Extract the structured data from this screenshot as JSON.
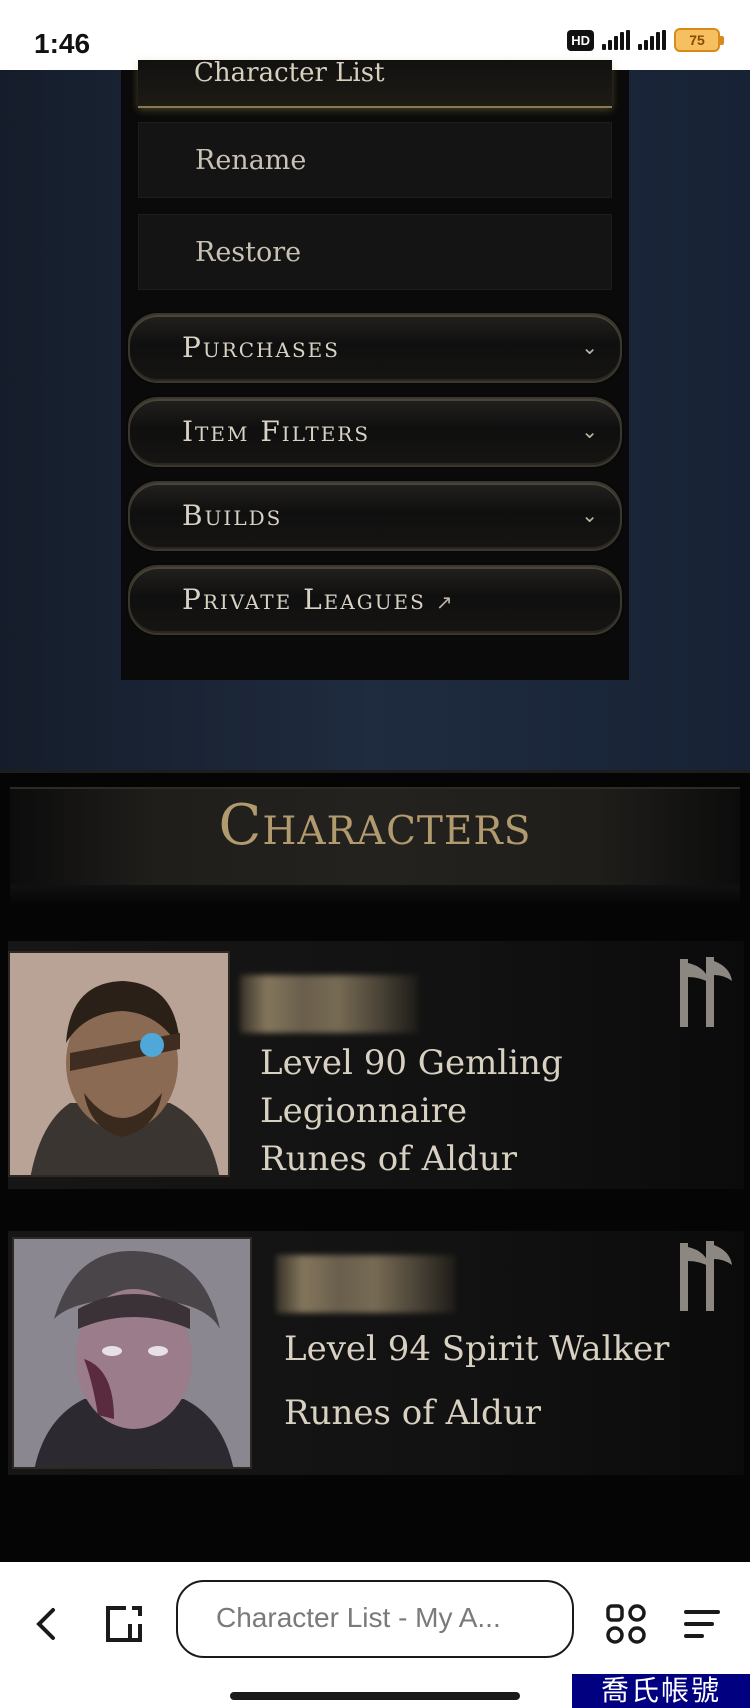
{
  "status_bar": {
    "time": "1:46",
    "network_badge": "HD",
    "battery": "75"
  },
  "menu": {
    "header_label": "Character List",
    "sub_items": [
      "Rename",
      "Restore"
    ],
    "accordions": [
      {
        "label": "Purchases",
        "icon": "chevron-down-icon"
      },
      {
        "label": "Item Filters",
        "icon": "chevron-down-icon"
      },
      {
        "label": "Builds",
        "icon": "chevron-down-icon"
      },
      {
        "label": "Private Leagues",
        "icon": "external-link-icon"
      }
    ]
  },
  "characters": {
    "title": "Characters",
    "list": [
      {
        "level_class": "Level 90 Gemling Legionnaire",
        "league": "Runes of Aldur",
        "class_icon": "axe-icon"
      },
      {
        "level_class": "Level 94 Spirit Walker",
        "league": "Runes of Aldur",
        "class_icon": "axe-icon"
      }
    ]
  },
  "browser": {
    "url_text": "Character List - My A...",
    "icons": [
      "back-icon",
      "tab-switch-icon",
      "apps-grid-icon",
      "menu-icon"
    ]
  },
  "watermark": "喬氏帳號",
  "colors": {
    "title_gold": "#b19a6e",
    "panel_black": "#0a0a0a",
    "page_navy": "#1c2636"
  }
}
